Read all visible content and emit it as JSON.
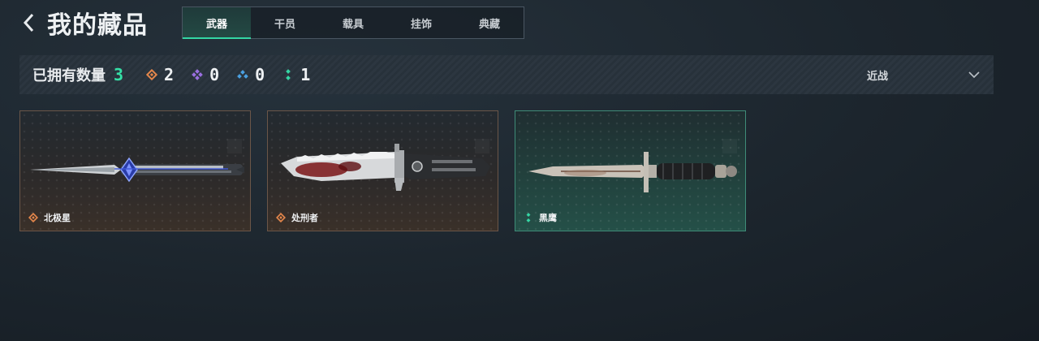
{
  "header": {
    "back_icon": "chevron-left-icon",
    "title": "我的藏品"
  },
  "tabs": [
    {
      "label": "武器",
      "active": true
    },
    {
      "label": "干员",
      "active": false
    },
    {
      "label": "载具",
      "active": false
    },
    {
      "label": "挂饰",
      "active": false
    },
    {
      "label": "典藏",
      "active": false
    }
  ],
  "stats": {
    "owned_label": "已拥有数量",
    "owned_count": "3",
    "rarities": [
      {
        "icon": "orange-diamond-icon",
        "color": "#e3864b",
        "count": "2"
      },
      {
        "icon": "purple-diamond-icon",
        "color": "#9a6fe0",
        "count": "0"
      },
      {
        "icon": "blue-triangle-icon",
        "color": "#4aa0e0",
        "count": "0"
      },
      {
        "icon": "green-dots-icon",
        "color": "#35d6a4",
        "count": "1"
      }
    ]
  },
  "filter": {
    "label": "近战",
    "icon": "chevron-down-icon"
  },
  "items": [
    {
      "name": "北极星",
      "rarity_icon": "orange-diamond-icon",
      "rarity_color": "#e3864b"
    },
    {
      "name": "处刑者",
      "rarity_icon": "orange-diamond-icon",
      "rarity_color": "#e3864b"
    },
    {
      "name": "黑鹰",
      "rarity_icon": "green-dots-icon",
      "rarity_color": "#35d6a4"
    }
  ],
  "colors": {
    "accent": "#35e0a6",
    "background": "#1c252d"
  }
}
